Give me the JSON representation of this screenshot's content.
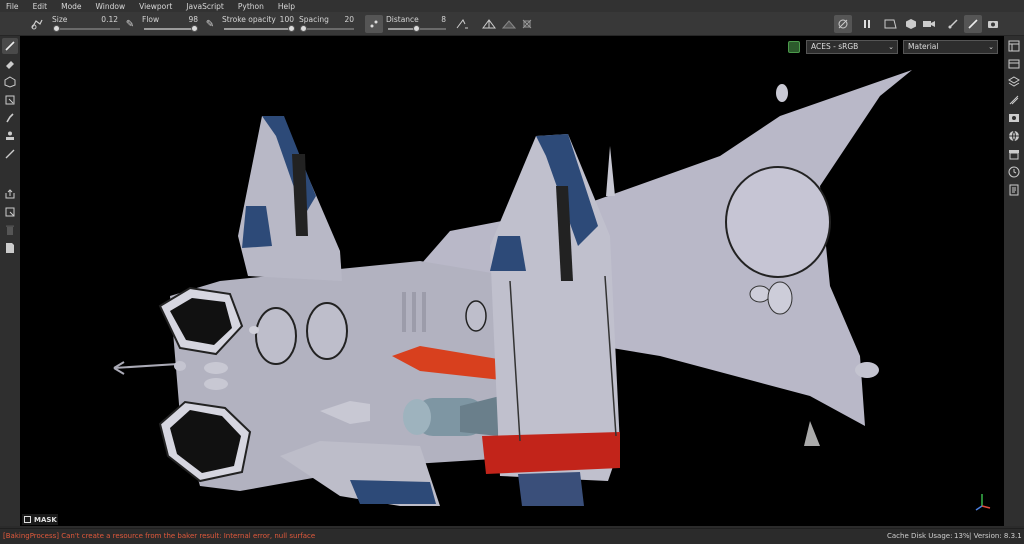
{
  "menu": [
    "File",
    "Edit",
    "Mode",
    "Window",
    "Viewport",
    "JavaScript",
    "Python",
    "Help"
  ],
  "toolbar": {
    "size": {
      "label": "Size",
      "value": "0.12",
      "level": 0.05
    },
    "flow": {
      "label": "Flow",
      "value": "98",
      "level": 0.98
    },
    "stroke_opacity": {
      "label": "Stroke opacity",
      "value": "100",
      "level": 1.0
    },
    "spacing": {
      "label": "Spacing",
      "value": "20",
      "level": 0.08
    },
    "distance": {
      "label": "Distance",
      "value": "8",
      "level": 0.5
    }
  },
  "viewport": {
    "colorspace": "ACES - sRGB",
    "channel": "Material",
    "mask_label": "MASK"
  },
  "status": {
    "error": "[BakingProcess] Can't create a resource from the baker result: Internal error, null surface",
    "cache_label": "Cache Disk Usage:",
    "cache_value": "13%",
    "version": "| Version: 8.3.1"
  },
  "colors": {
    "error": "#e0593c",
    "ship_body": "#b9b8c8",
    "ship_blue": "#2d4a78",
    "ship_red": "#c2241a",
    "ship_orange": "#d8401e"
  }
}
